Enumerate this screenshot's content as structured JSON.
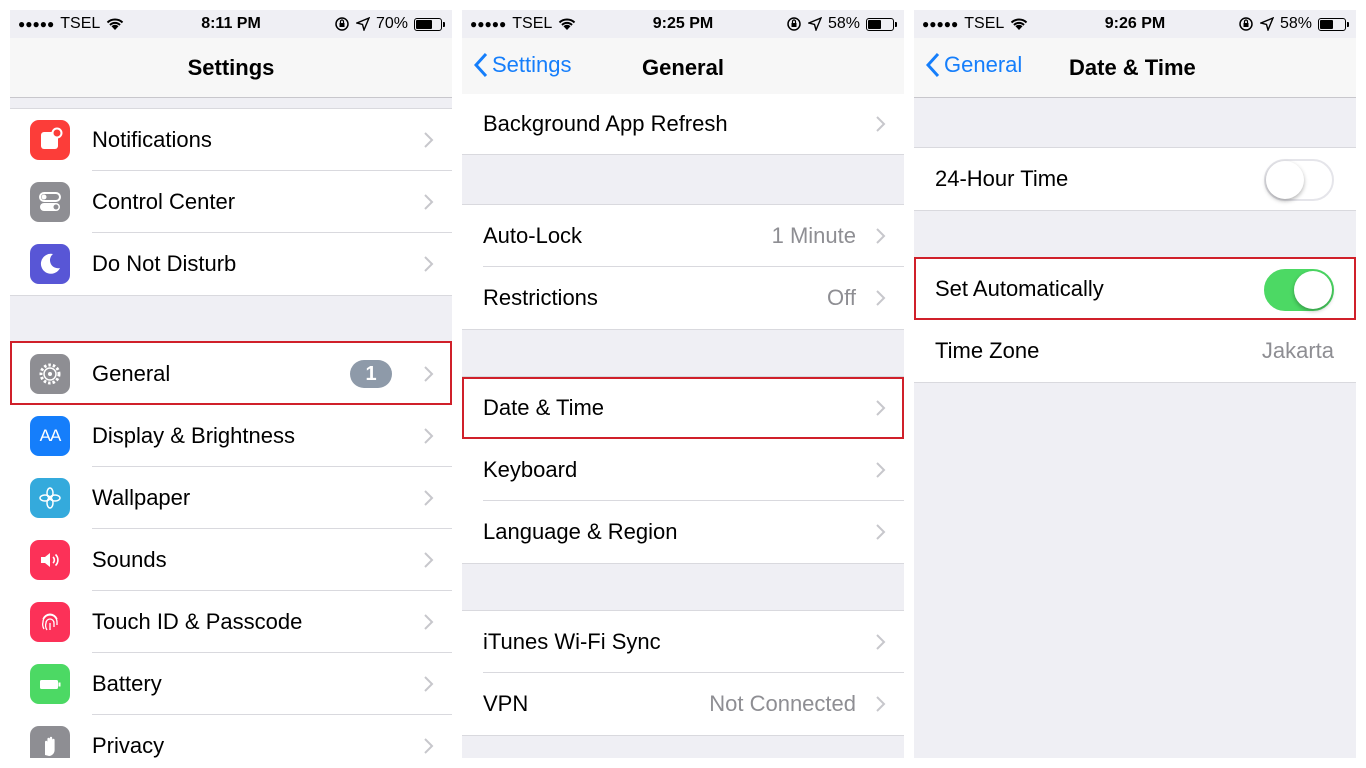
{
  "panels": [
    {
      "status": {
        "carrier": "TSEL",
        "time": "8:11 PM",
        "battery": "70%",
        "battery_level": 0.7
      },
      "nav": {
        "title": "Settings"
      },
      "groups": [
        [
          {
            "label": "Notifications",
            "icon": "notifications-icon",
            "color": "#fc3d39"
          },
          {
            "label": "Control Center",
            "icon": "control-center-icon",
            "color": "#8e8e93"
          },
          {
            "label": "Do Not Disturb",
            "icon": "moon-icon",
            "color": "#5856d6"
          }
        ],
        [
          {
            "label": "General",
            "icon": "gear-icon",
            "color": "#8e8e93",
            "badge": "1"
          },
          {
            "label": "Display & Brightness",
            "icon": "display-icon",
            "color": "#157efb",
            "glyph": "AA"
          },
          {
            "label": "Wallpaper",
            "icon": "wallpaper-icon",
            "color": "#34aadc"
          },
          {
            "label": "Sounds",
            "icon": "speaker-icon",
            "color": "#fc3158"
          },
          {
            "label": "Touch ID & Passcode",
            "icon": "fingerprint-icon",
            "color": "#fc3158"
          },
          {
            "label": "Battery",
            "icon": "battery-icon",
            "color": "#4cd964"
          },
          {
            "label": "Privacy",
            "icon": "hand-icon",
            "color": "#8e8e93"
          }
        ]
      ]
    },
    {
      "status": {
        "carrier": "TSEL",
        "time": "9:25 PM",
        "battery": "58%",
        "battery_level": 0.58
      },
      "nav": {
        "back": "Settings",
        "title": "General"
      },
      "groups": [
        [
          {
            "label": "Background App Refresh"
          }
        ],
        [
          {
            "label": "Auto-Lock",
            "value": "1 Minute"
          },
          {
            "label": "Restrictions",
            "value": "Off"
          }
        ],
        [
          {
            "label": "Date & Time"
          },
          {
            "label": "Keyboard"
          },
          {
            "label": "Language & Region"
          }
        ],
        [
          {
            "label": "iTunes Wi-Fi Sync"
          },
          {
            "label": "VPN",
            "value": "Not Connected"
          }
        ]
      ]
    },
    {
      "status": {
        "carrier": "TSEL",
        "time": "9:26 PM",
        "battery": "58%",
        "battery_level": 0.58
      },
      "nav": {
        "back": "General",
        "title": "Date & Time"
      },
      "groups": [
        [
          {
            "label": "24-Hour Time",
            "toggle": false
          }
        ],
        [
          {
            "label": "Set Automatically",
            "toggle": true
          },
          {
            "label": "Time Zone",
            "value": "Jakarta"
          }
        ]
      ]
    }
  ],
  "colors": {
    "accent": "#157efb",
    "highlight": "#d0202a",
    "toggle_on": "#4cd964"
  }
}
